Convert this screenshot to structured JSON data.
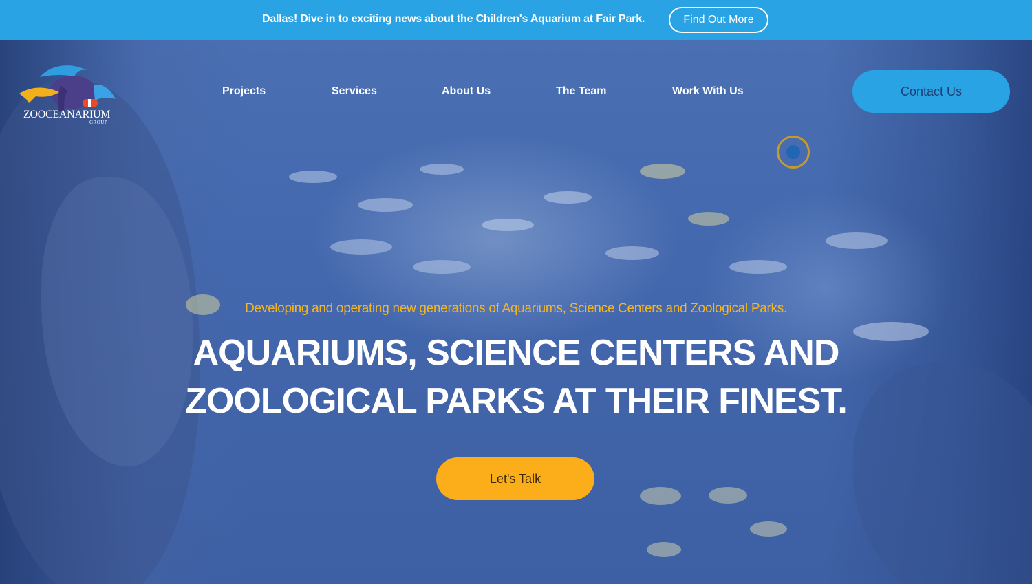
{
  "announcement": {
    "text": "Dallas! Dive in to exciting news about the Children's Aquarium at Fair Park.",
    "button_label": "Find Out More"
  },
  "logo": {
    "name": "ZOOCEANARIUM",
    "sub": "GROUP"
  },
  "nav": {
    "items": [
      "Projects",
      "Services",
      "About Us",
      "The Team",
      "Work With Us"
    ],
    "contact_label": "Contact Us"
  },
  "hero": {
    "tagline": "Developing and operating new generations of Aquariums, Science Centers and Zoological Parks.",
    "headline_line1": "AQUARIUMS, SCIENCE CENTERS AND",
    "headline_line2": "ZOOLOGICAL PARKS AT THEIR FINEST.",
    "cta_label": "Let's Talk"
  },
  "colors": {
    "topbar": "#29a3e3",
    "accent_yellow": "#fbae1a",
    "tagline": "#f4b521",
    "contact_button": "#29a3e3",
    "hero_water": "#4468ae"
  }
}
